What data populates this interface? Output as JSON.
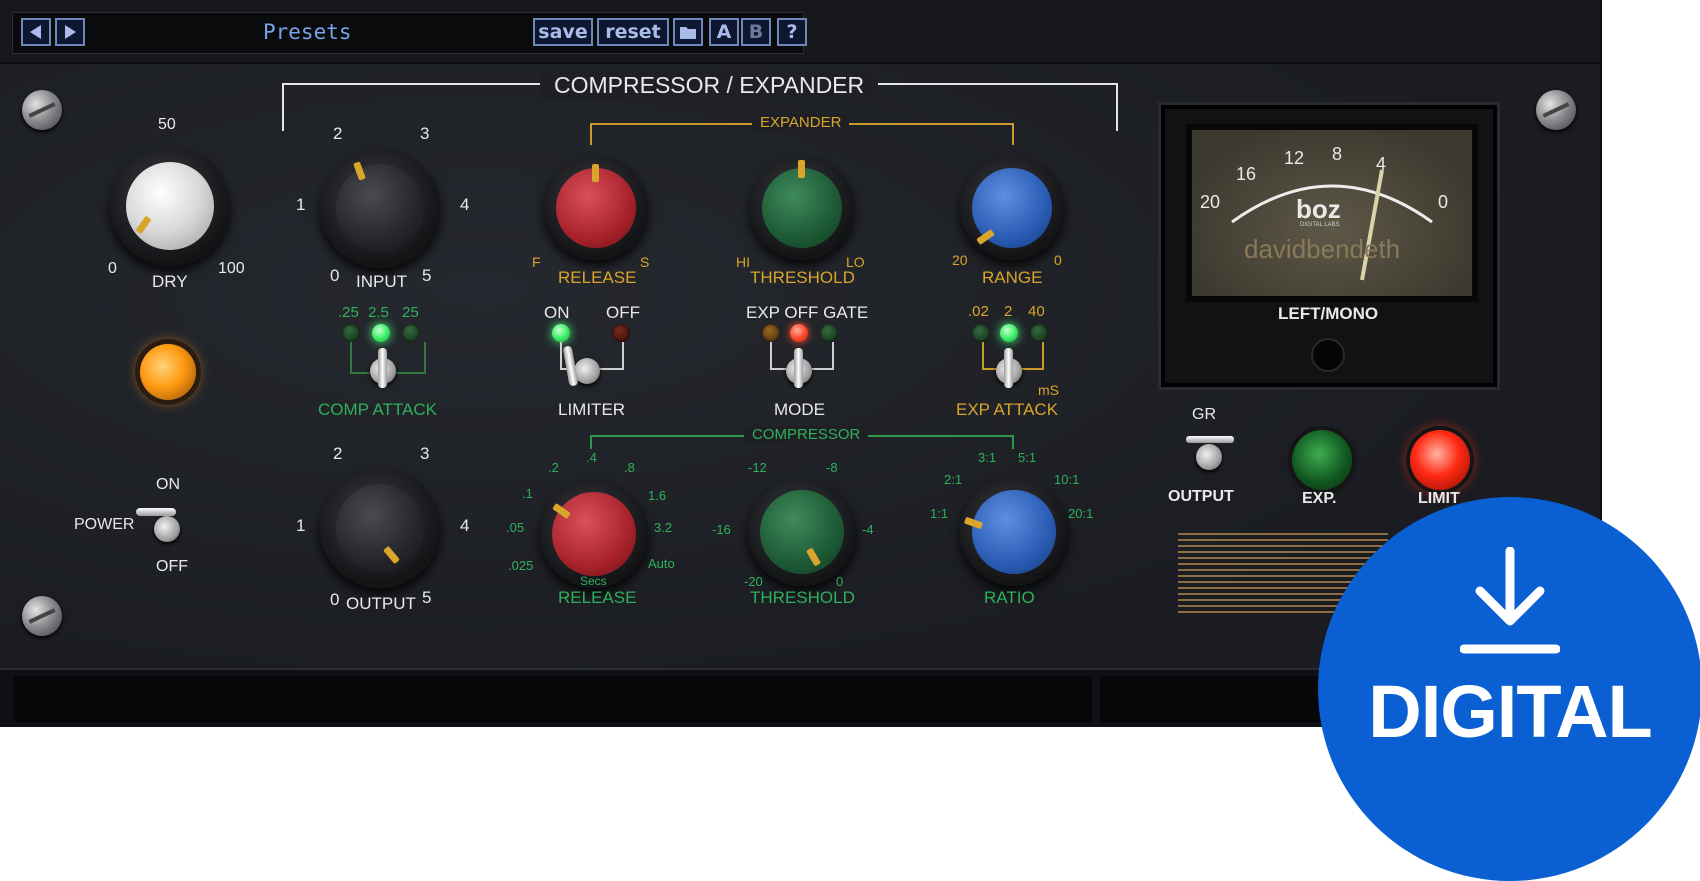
{
  "toolbar": {
    "prev_icon": "triangle-left-icon",
    "next_icon": "triangle-right-icon",
    "presets_label": "Presets",
    "save_label": "save",
    "reset_label": "reset",
    "folder_icon": "folder-icon",
    "a_label": "A",
    "b_label": "B",
    "help_label": "?"
  },
  "section_titles": {
    "main": "COMPRESSOR / EXPANDER",
    "expander": "EXPANDER",
    "compressor": "COMPRESSOR"
  },
  "dry": {
    "label": "DRY",
    "ticks": [
      "0",
      "50",
      "100"
    ]
  },
  "input": {
    "label": "INPUT",
    "ticks": [
      "0",
      "1",
      "2",
      "3",
      "4",
      "5"
    ]
  },
  "output_knob": {
    "label": "OUTPUT",
    "ticks": [
      "0",
      "1",
      "2",
      "3",
      "4",
      "5"
    ]
  },
  "expander": {
    "release": {
      "label": "RELEASE",
      "min": "F",
      "max": "S"
    },
    "threshold": {
      "label": "THRESHOLD",
      "min": "HI",
      "max": "LO"
    },
    "range": {
      "label": "RANGE",
      "min": "20",
      "max": "0"
    }
  },
  "comp_attack": {
    "label": "COMP ATTACK",
    "options": [
      ".25",
      "2.5",
      "25"
    ],
    "selected": "2.5"
  },
  "limiter": {
    "label": "LIMITER",
    "on_label": "ON",
    "off_label": "OFF",
    "state": "ON"
  },
  "mode": {
    "label": "MODE",
    "options_label": "EXP OFF GATE",
    "selected": "OFF"
  },
  "exp_attack": {
    "label": "EXP ATTACK",
    "options": [
      ".02",
      "2",
      "40"
    ],
    "selected": "2",
    "unit": "mS"
  },
  "compressor": {
    "release": {
      "label": "RELEASE",
      "unit": "Secs",
      "ticks": [
        ".025",
        ".05",
        ".1",
        ".2",
        ".4",
        ".8",
        "1.6",
        "3.2",
        "Auto"
      ]
    },
    "threshold": {
      "label": "THRESHOLD",
      "ticks": [
        "-20",
        "-16",
        "-12",
        "-8",
        "-4",
        "0"
      ]
    },
    "ratio": {
      "label": "RATIO",
      "ticks": [
        "1:1",
        "2:1",
        "3:1",
        "5:1",
        "10:1",
        "20:1"
      ]
    }
  },
  "power": {
    "label": "POWER",
    "on_label": "ON",
    "off_label": "OFF",
    "state": "ON"
  },
  "meter": {
    "scale": [
      "20",
      "16",
      "12",
      "8",
      "4",
      "0"
    ],
    "brand": "boz",
    "brand_sub": "DIGITAL LABS",
    "signature": "davidbendeth",
    "channel_label": "LEFT/MONO"
  },
  "meter_switch": {
    "top_label": "GR",
    "bottom_label": "OUTPUT"
  },
  "indicators": {
    "exp_label": "EXP.",
    "limit_label": "LIMIT"
  },
  "badge": {
    "text": "DIGITAL",
    "icon": "download-arrow-icon",
    "color": "#0a5fd2"
  },
  "colors": {
    "panel": "#1b1d22",
    "accent_yellow": "#d9a52a",
    "accent_green": "#2fb05a",
    "toolbar_blue": "#6f86b8"
  }
}
